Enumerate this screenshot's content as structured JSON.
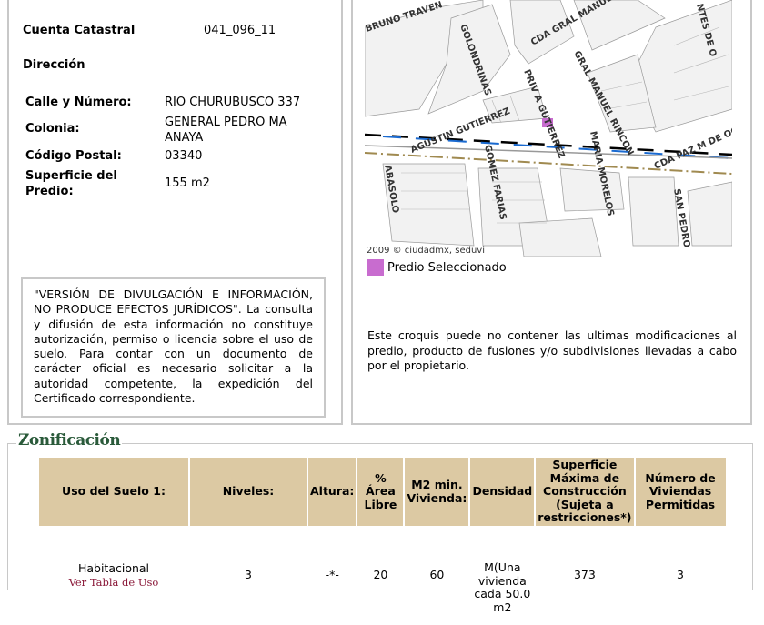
{
  "predio": {
    "cuenta_label": "Cuenta Catastral",
    "cuenta_value": "041_096_11",
    "direccion_label": "Dirección",
    "calle_label": "Calle y Número:",
    "calle_value": "RIO CHURUBUSCO 337",
    "colonia_label": "Colonia:",
    "colonia_value": "GENERAL PEDRO MA ANAYA",
    "cp_label": "Código Postal:",
    "cp_value": "03340",
    "superficie_label": "Superficie del Predio:",
    "superficie_value": "155 m2"
  },
  "disclaimer": "\"VERSIÓN DE DIVULGACIÓN E INFORMACIÓN, NO PRODUCE EFECTOS JURÍDICOS\". La consulta y difusión de esta información no constituye autorización, permiso o licencia sobre el uso de suelo. Para contar con un documento de carácter oficial es necesario solicitar a la autoridad competente, la expedición del Certificado correspondiente.",
  "map": {
    "streets": [
      "BRUNO TRAVEN",
      "GOLONDRINAS",
      "CDA GRAL MANUEL",
      "GRAL MANUEL RINCON",
      "PRIV A GUTIERREZ",
      "AGUSTIN GUTIERREZ",
      "CDA PAZ M DE OC",
      "GOMEZ FARIAS",
      "MARIA MORELOS",
      "ABASOLO",
      "SAN PEDRO",
      "NTES DE O"
    ],
    "copyright": "2009 © ciudadmx, seduvi",
    "selected_color": "#c86ccf"
  },
  "legend": {
    "label": "Predio Seleccionado"
  },
  "note": "Este croquis puede no contener las ultimas modificaciones al predio, producto de fusiones y/o subdivisiones llevadas a cabo por el propietario.",
  "zonificacion": {
    "title": "Zonificación",
    "headers": [
      "Uso del Suelo 1:",
      "Niveles:",
      "Altura:",
      "% Área Libre",
      "M2 min. Vivienda:",
      "Densidad",
      "Superficie Máxima de Construcción (Sujeta a restricciones*)",
      "Número de Viviendas Permitidas"
    ],
    "row": {
      "uso": "Habitacional",
      "uso_link": "Ver Tabla de Uso",
      "niveles": "3",
      "altura": "-*-",
      "area_libre": "20",
      "m2_min": "60",
      "densidad": "M(Una vivienda cada 50.0 m2",
      "superficie_max": "373",
      "viviendas": "3"
    }
  }
}
